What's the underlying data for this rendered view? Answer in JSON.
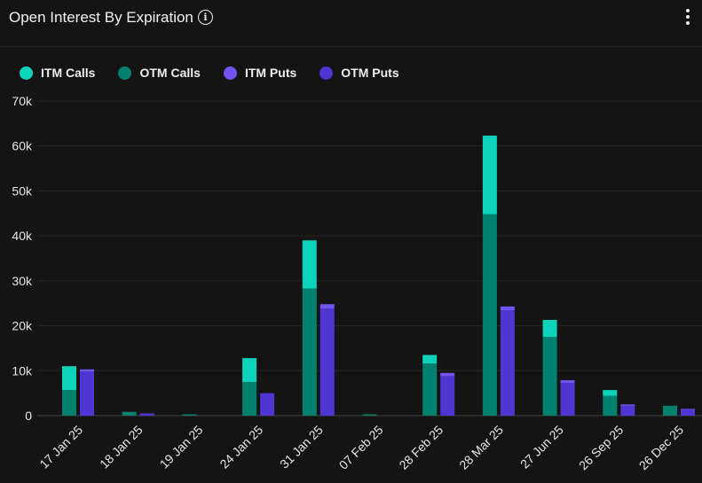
{
  "header": {
    "title": "Open Interest By Expiration",
    "info_icon": "i"
  },
  "colors": {
    "itm_calls": "#0dd3bb",
    "otm_calls": "#00806f",
    "itm_puts": "#7354f0",
    "otm_puts": "#4f35d2"
  },
  "chart_data": {
    "type": "bar",
    "stacked": true,
    "title": "Open Interest By Expiration",
    "categories": [
      "17 Jan 25",
      "18 Jan 25",
      "19 Jan 25",
      "24 Jan 25",
      "31 Jan 25",
      "07 Feb 25",
      "28 Feb 25",
      "28 Mar 25",
      "27 Jun 25",
      "26 Sep 25",
      "26 Dec 25"
    ],
    "series": [
      {
        "name": "ITM Calls",
        "stack": "calls",
        "values": [
          5300,
          0,
          0,
          5300,
          10700,
          0,
          1900,
          17500,
          3800,
          1300,
          0
        ]
      },
      {
        "name": "OTM Calls",
        "stack": "calls",
        "values": [
          5700,
          850,
          300,
          7500,
          28300,
          300,
          11600,
          44800,
          17500,
          4400,
          2200
        ]
      },
      {
        "name": "ITM Puts",
        "stack": "puts",
        "values": [
          500,
          0,
          0,
          0,
          1000,
          0,
          700,
          900,
          600,
          300,
          200
        ]
      },
      {
        "name": "OTM Puts",
        "stack": "puts",
        "values": [
          9800,
          500,
          0,
          5000,
          23800,
          0,
          8800,
          23400,
          7300,
          2200,
          1300
        ]
      }
    ],
    "yticks": [
      "0",
      "10k",
      "20k",
      "30k",
      "40k",
      "50k",
      "60k",
      "70k"
    ],
    "ylim": [
      0,
      70000
    ],
    "grid": true,
    "legend": "top-left"
  }
}
